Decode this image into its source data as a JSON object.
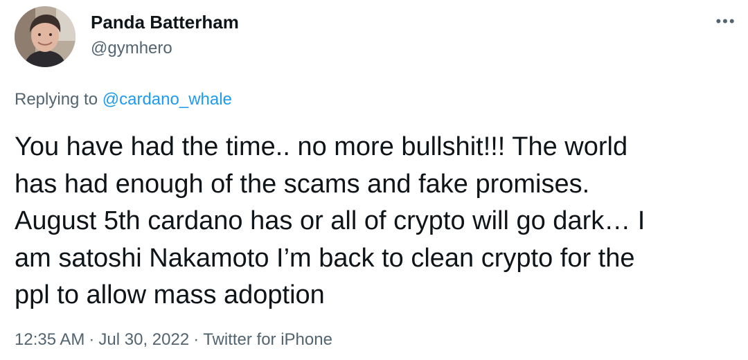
{
  "author": {
    "display_name": "Panda Batterham",
    "handle": "@gymhero"
  },
  "more_icon": "more-dots-icon",
  "more_glyph": "•••",
  "reply": {
    "prefix": "Replying to ",
    "mention": "@cardano_whale"
  },
  "tweet": {
    "lines": [
      "You have had the time.. no more bullshit!!! The world",
      "has had enough of the scams and fake promises.",
      "August 5th cardano has or all of crypto will go dark… I",
      "am satoshi Nakamoto I’m back to clean crypto for the",
      "ppl to allow mass adoption"
    ]
  },
  "meta": {
    "time": "12:35 AM",
    "separator": "·",
    "date": "Jul 30, 2022",
    "source": "Twitter for iPhone"
  },
  "colors": {
    "text": "#0f1419",
    "secondary": "#536471",
    "link": "#1d9bf0"
  }
}
